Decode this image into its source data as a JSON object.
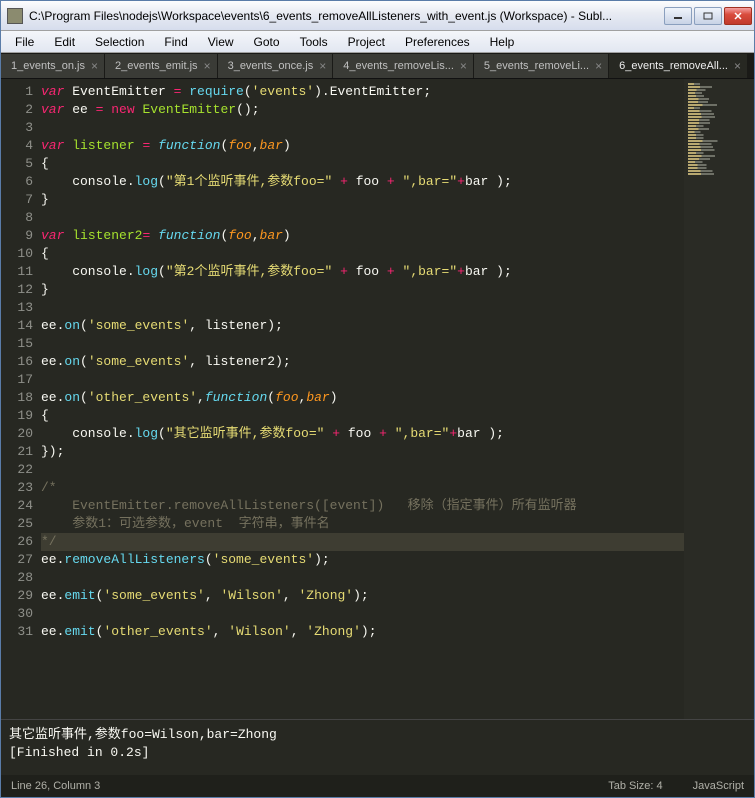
{
  "window": {
    "title": "C:\\Program Files\\nodejs\\Workspace\\events\\6_events_removeAllListeners_with_event.js (Workspace) - Subl..."
  },
  "menu": {
    "file": "File",
    "edit": "Edit",
    "selection": "Selection",
    "find": "Find",
    "view": "View",
    "goto": "Goto",
    "tools": "Tools",
    "project": "Project",
    "preferences": "Preferences",
    "help": "Help"
  },
  "tabs": [
    {
      "label": "1_events_on.js",
      "active": false
    },
    {
      "label": "2_events_emit.js",
      "active": false
    },
    {
      "label": "3_events_once.js",
      "active": false
    },
    {
      "label": "4_events_removeLis...",
      "active": false
    },
    {
      "label": "5_events_removeLi...",
      "active": false
    },
    {
      "label": "6_events_removeAll...",
      "active": true
    }
  ],
  "code_tokens": [
    [
      [
        "kw",
        "var"
      ],
      [
        "pl",
        " EventEmitter "
      ],
      [
        "op",
        "="
      ],
      [
        "pl",
        " "
      ],
      [
        "fn",
        "require"
      ],
      [
        "pl",
        "("
      ],
      [
        "str",
        "'events'"
      ],
      [
        "pl",
        ")."
      ],
      [
        "pl",
        "EventEmitter"
      ],
      [
        "pl",
        ";"
      ]
    ],
    [
      [
        "kw",
        "var"
      ],
      [
        "pl",
        " ee "
      ],
      [
        "op",
        "="
      ],
      [
        "pl",
        " "
      ],
      [
        "op",
        "new"
      ],
      [
        "pl",
        " "
      ],
      [
        "name",
        "EventEmitter"
      ],
      [
        "pl",
        "();"
      ]
    ],
    [],
    [
      [
        "kw",
        "var"
      ],
      [
        "pl",
        " "
      ],
      [
        "name",
        "listener"
      ],
      [
        "pl",
        " "
      ],
      [
        "op",
        "="
      ],
      [
        "pl",
        " "
      ],
      [
        "kw2",
        "function"
      ],
      [
        "pl",
        "("
      ],
      [
        "param",
        "foo"
      ],
      [
        "pl",
        ","
      ],
      [
        "param",
        "bar"
      ],
      [
        "pl",
        ")"
      ]
    ],
    [
      [
        "pl",
        "{"
      ]
    ],
    [
      [
        "pl",
        "    console."
      ],
      [
        "fn",
        "log"
      ],
      [
        "pl",
        "("
      ],
      [
        "str",
        "\"第1个监听事件,参数foo=\""
      ],
      [
        "pl",
        " "
      ],
      [
        "op",
        "+"
      ],
      [
        "pl",
        " foo "
      ],
      [
        "op",
        "+"
      ],
      [
        "pl",
        " "
      ],
      [
        "str",
        "\",bar=\""
      ],
      [
        "op",
        "+"
      ],
      [
        "pl",
        "bar );"
      ]
    ],
    [
      [
        "pl",
        "}"
      ]
    ],
    [],
    [
      [
        "kw",
        "var"
      ],
      [
        "pl",
        " "
      ],
      [
        "name",
        "listener2"
      ],
      [
        "op",
        "="
      ],
      [
        "pl",
        " "
      ],
      [
        "kw2",
        "function"
      ],
      [
        "pl",
        "("
      ],
      [
        "param",
        "foo"
      ],
      [
        "pl",
        ","
      ],
      [
        "param",
        "bar"
      ],
      [
        "pl",
        ")"
      ]
    ],
    [
      [
        "pl",
        "{"
      ]
    ],
    [
      [
        "pl",
        "    console."
      ],
      [
        "fn",
        "log"
      ],
      [
        "pl",
        "("
      ],
      [
        "str",
        "\"第2个监听事件,参数foo=\""
      ],
      [
        "pl",
        " "
      ],
      [
        "op",
        "+"
      ],
      [
        "pl",
        " foo "
      ],
      [
        "op",
        "+"
      ],
      [
        "pl",
        " "
      ],
      [
        "str",
        "\",bar=\""
      ],
      [
        "op",
        "+"
      ],
      [
        "pl",
        "bar );"
      ]
    ],
    [
      [
        "pl",
        "}"
      ]
    ],
    [],
    [
      [
        "pl",
        "ee."
      ],
      [
        "fn",
        "on"
      ],
      [
        "pl",
        "("
      ],
      [
        "str",
        "'some_events'"
      ],
      [
        "pl",
        ", listener);"
      ]
    ],
    [],
    [
      [
        "pl",
        "ee."
      ],
      [
        "fn",
        "on"
      ],
      [
        "pl",
        "("
      ],
      [
        "str",
        "'some_events'"
      ],
      [
        "pl",
        ", listener2);"
      ]
    ],
    [],
    [
      [
        "pl",
        "ee."
      ],
      [
        "fn",
        "on"
      ],
      [
        "pl",
        "("
      ],
      [
        "str",
        "'other_events'"
      ],
      [
        "pl",
        ","
      ],
      [
        "kw2",
        "function"
      ],
      [
        "pl",
        "("
      ],
      [
        "param",
        "foo"
      ],
      [
        "pl",
        ","
      ],
      [
        "param",
        "bar"
      ],
      [
        "pl",
        ")"
      ]
    ],
    [
      [
        "pl",
        "{"
      ]
    ],
    [
      [
        "pl",
        "    console."
      ],
      [
        "fn",
        "log"
      ],
      [
        "pl",
        "("
      ],
      [
        "str",
        "\"其它监听事件,参数foo=\""
      ],
      [
        "pl",
        " "
      ],
      [
        "op",
        "+"
      ],
      [
        "pl",
        " foo "
      ],
      [
        "op",
        "+"
      ],
      [
        "pl",
        " "
      ],
      [
        "str",
        "\",bar=\""
      ],
      [
        "op",
        "+"
      ],
      [
        "pl",
        "bar );"
      ]
    ],
    [
      [
        "pl",
        "});"
      ]
    ],
    [],
    [
      [
        "cm",
        "/*"
      ]
    ],
    [
      [
        "cm",
        "    EventEmitter.removeAllListeners([event])   移除（指定事件）所有监听器"
      ]
    ],
    [
      [
        "cm",
        "    参数1：可选参数，event  字符串，事件名"
      ]
    ],
    [
      [
        "cm",
        "*/"
      ]
    ],
    [
      [
        "pl",
        "ee."
      ],
      [
        "fn",
        "removeAllListeners"
      ],
      [
        "pl",
        "("
      ],
      [
        "str",
        "'some_events'"
      ],
      [
        "pl",
        ");"
      ]
    ],
    [],
    [
      [
        "pl",
        "ee."
      ],
      [
        "fn",
        "emit"
      ],
      [
        "pl",
        "("
      ],
      [
        "str",
        "'some_events'"
      ],
      [
        "pl",
        ", "
      ],
      [
        "str",
        "'Wilson'"
      ],
      [
        "pl",
        ", "
      ],
      [
        "str",
        "'Zhong'"
      ],
      [
        "pl",
        ");"
      ]
    ],
    [],
    [
      [
        "pl",
        "ee."
      ],
      [
        "fn",
        "emit"
      ],
      [
        "pl",
        "("
      ],
      [
        "str",
        "'other_events'"
      ],
      [
        "pl",
        ", "
      ],
      [
        "str",
        "'Wilson'"
      ],
      [
        "pl",
        ", "
      ],
      [
        "str",
        "'Zhong'"
      ],
      [
        "pl",
        ");"
      ]
    ]
  ],
  "highlight_line": 26,
  "output": {
    "line1": "其它监听事件,参数foo=Wilson,bar=Zhong",
    "line2": "[Finished in 0.2s]"
  },
  "status": {
    "position": "Line 26, Column 3",
    "tabsize": "Tab Size: 4",
    "syntax": "JavaScript"
  }
}
